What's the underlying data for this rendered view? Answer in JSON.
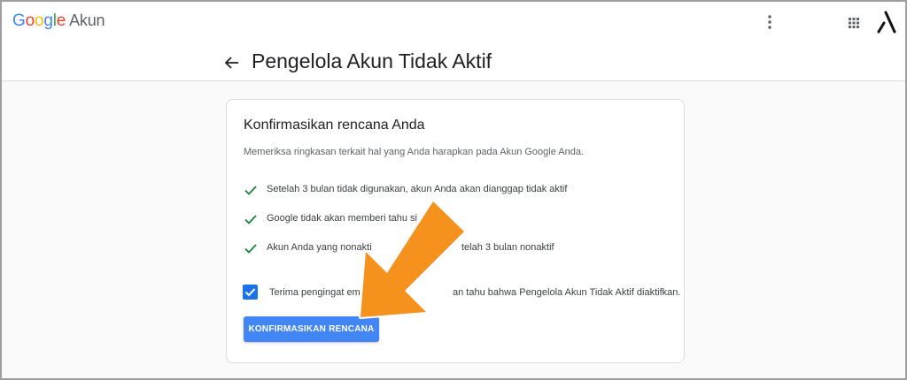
{
  "header": {
    "logo": {
      "g1": "G",
      "g2": "o",
      "g3": "o",
      "g4": "g",
      "g5": "l",
      "g6": "e",
      "product": "Akun"
    },
    "icons": {
      "more": "more-vert-icon",
      "apps": "apps-grid-icon",
      "avatar": "account-avatar-icon"
    }
  },
  "page": {
    "title": "Pengelola Akun Tidak Aktif",
    "back_icon": "arrow-back-icon"
  },
  "card": {
    "title": "Konfirmasikan rencana Anda",
    "subtitle": "Memeriksa ringkasan terkait hal yang Anda harapkan pada Akun Google Anda.",
    "items": [
      {
        "text": "Setelah 3 bulan tidak digunakan, akun Anda akan dianggap tidak aktif"
      },
      {
        "text": "Google tidak akan memberi tahu si"
      },
      {
        "text": "Akun Anda yang nonakti"
      },
      {
        "text": "telah 3 bulan nonaktif"
      }
    ],
    "checkbox": {
      "checked": true,
      "label_start": "Terima pengingat emai",
      "label_end": "an tahu bahwa Pengelola Akun Tidak Aktif diaktifkan."
    },
    "confirm_button": "KONFIRMASIKAN RENCANA"
  },
  "annotation": {
    "arrow_color": "#f5921e"
  },
  "colors": {
    "primary": "#4285f4",
    "check": "#188038",
    "checkbox": "#1a73e8"
  }
}
